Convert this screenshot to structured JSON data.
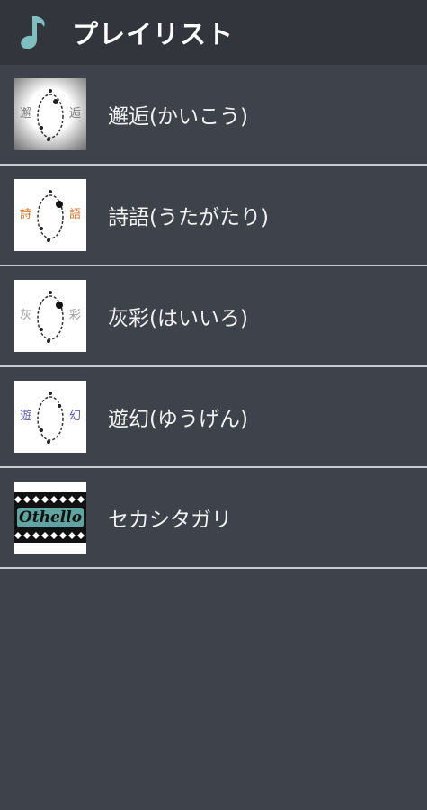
{
  "header": {
    "title": "プレイリスト",
    "icon": "music-note-icon",
    "accent_color": "#7fbfbf"
  },
  "playlist": [
    {
      "name": "邂逅(かいこう)",
      "art": "album-art-kaikou",
      "glyph_left": "邂",
      "glyph_right": "逅",
      "glyph_color": "#7d7d7d"
    },
    {
      "name": "詩語(うたがたり)",
      "art": "album-art-utagatari",
      "glyph_left": "詩",
      "glyph_right": "語",
      "glyph_color": "#d9772e"
    },
    {
      "name": "灰彩(はいいろ)",
      "art": "album-art-haiiro",
      "glyph_left": "灰",
      "glyph_right": "彩",
      "glyph_color": "#a0a0a0"
    },
    {
      "name": "遊幻(ゆうげん)",
      "art": "album-art-yuugen",
      "glyph_left": "遊",
      "glyph_right": "幻",
      "glyph_color": "#5a5aa8"
    },
    {
      "name": "セカシタガリ",
      "art": "album-art-sekashitagari",
      "logo_text": "Othello"
    }
  ]
}
